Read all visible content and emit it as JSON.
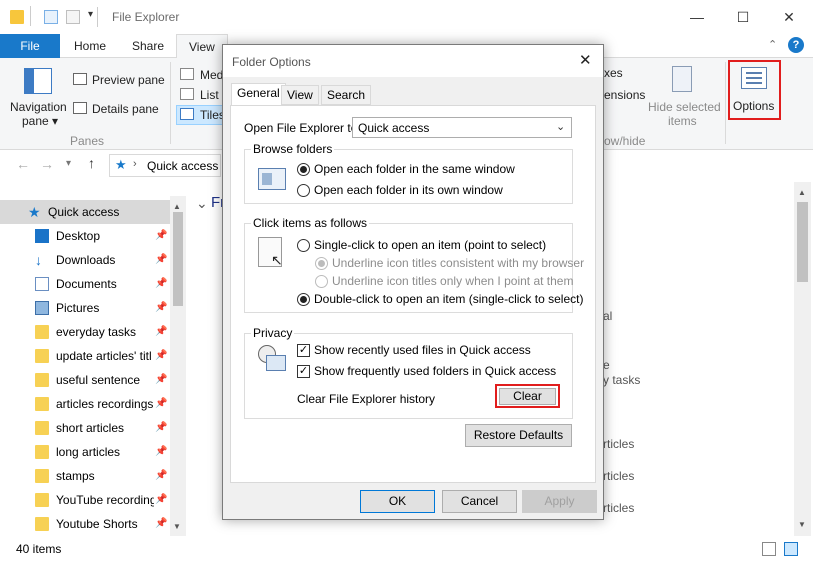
{
  "explorer": {
    "title": "File Explorer",
    "tabs": [
      "File",
      "Home",
      "Share",
      "View"
    ],
    "ribbon": {
      "navigation_pane_line1": "Navigation",
      "navigation_pane_line2": "pane",
      "preview_pane": "Preview pane",
      "details_pane": "Details pane",
      "panes_group": "Panes",
      "layout_medium": "Med",
      "layout_list": "List",
      "layout_tiles": "Tiles",
      "extensions_partial": "xes",
      "extensions_partial2": "ensions",
      "show_hide_partial": "ow/hide",
      "hide_selected_line1": "Hide selected",
      "hide_selected_line2": "items",
      "options": "Options"
    },
    "address": {
      "path": "Quick access"
    },
    "content_header": "Fr",
    "nav_items": [
      {
        "label": "Quick access",
        "type": "star"
      },
      {
        "label": "Desktop",
        "type": "desktop"
      },
      {
        "label": "Downloads",
        "type": "download"
      },
      {
        "label": "Documents",
        "type": "documents"
      },
      {
        "label": "Pictures",
        "type": "pictures"
      },
      {
        "label": "everyday tasks",
        "type": "folder"
      },
      {
        "label": "update articles' titl",
        "type": "folder"
      },
      {
        "label": "useful sentence",
        "type": "folder"
      },
      {
        "label": "articles recordings",
        "type": "folder"
      },
      {
        "label": "short articles",
        "type": "folder"
      },
      {
        "label": "long articles",
        "type": "folder"
      },
      {
        "label": "stamps",
        "type": "folder"
      },
      {
        "label": "YouTube recording",
        "type": "folder"
      },
      {
        "label": "Youtube Shorts",
        "type": "folder"
      }
    ],
    "content_fragments": [
      "al",
      "e",
      "y tasks",
      "rticles",
      "rticles",
      "rticles"
    ],
    "status": {
      "items_count": "40 items"
    }
  },
  "dialog": {
    "title": "Folder Options",
    "tabs": [
      "General",
      "View",
      "Search"
    ],
    "open_explorer_label": "Open File Explorer to:",
    "open_explorer_value": "Quick access",
    "browse_group": "Browse folders",
    "browse_same": "Open each folder in the same window",
    "browse_own": "Open each folder in its own window",
    "click_group": "Click items as follows",
    "single_click": "Single-click to open an item (point to select)",
    "underline_consistent": "Underline icon titles consistent with my browser",
    "underline_point": "Underline icon titles only when I point at them",
    "double_click": "Double-click to open an item (single-click to select)",
    "privacy_group": "Privacy",
    "show_recent_files": "Show recently used files in Quick access",
    "show_frequent_folders": "Show frequently used folders in Quick access",
    "clear_history_label": "Clear File Explorer history",
    "clear_button": "Clear",
    "restore_defaults": "Restore Defaults",
    "ok": "OK",
    "cancel": "Cancel",
    "apply": "Apply"
  },
  "colors": {
    "accent": "#1979ca",
    "highlight": "#e11d1d",
    "selected": "#cce8ff"
  }
}
